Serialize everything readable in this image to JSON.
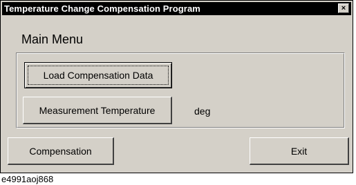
{
  "window": {
    "title": "Temperature Change Compensation Program",
    "close_glyph": "×"
  },
  "main": {
    "heading": "Main Menu",
    "load_button_label": "Load Compensation Data",
    "measure_button_label": "Measurement Temperature",
    "temperature_value": "",
    "temperature_unit": "deg"
  },
  "footer": {
    "compensation_button_label": "Compensation",
    "exit_button_label": "Exit"
  },
  "caption": "e4991aoj868",
  "colors": {
    "face": "#d4d0c8",
    "titlebar": "#000000",
    "title_text": "#ffffff"
  },
  "icons": {
    "close": "close-icon"
  }
}
